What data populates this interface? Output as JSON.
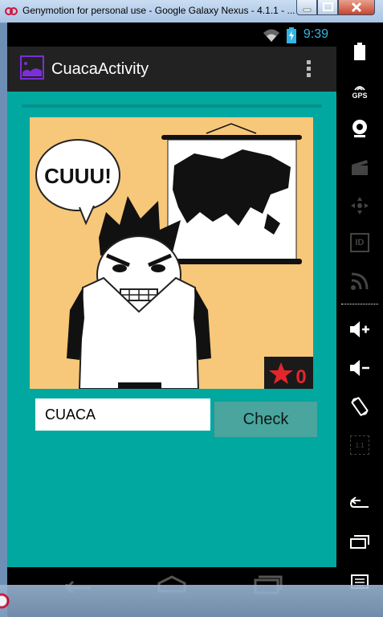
{
  "window": {
    "title": "Genymotion for personal use - Google Galaxy Nexus - 4.1.1 - ..."
  },
  "statusbar": {
    "time": "9:39"
  },
  "actionbar": {
    "title": "CuacaActivity"
  },
  "quiz": {
    "speech_bubble": "CUUU!",
    "score": "0",
    "answer_value": "CUACA",
    "check_label": "Check"
  },
  "side_panel": {
    "gps_label": "GPS",
    "id_label": "ID",
    "pixel_label": "1:1"
  },
  "colors": {
    "content_bg": "#00a8a0",
    "button_bg": "#4aa59e",
    "clock": "#33b5e5",
    "app_icon": "#7b2fd6",
    "card_bg": "#f7c77a",
    "score_star": "#e3262b"
  },
  "icons": {
    "status": [
      "wifi-icon",
      "battery-charging-icon"
    ],
    "actionbar": [
      "app-image-icon",
      "overflow-menu-icon"
    ],
    "side_panel": [
      "battery-icon",
      "gps-icon",
      "webcam-icon",
      "clapper-icon",
      "dpad-icon",
      "id-icon",
      "rss-icon",
      "volume-up-icon",
      "volume-down-icon",
      "rotate-icon",
      "pixel-perfect-icon",
      "back-icon",
      "recent-apps-icon",
      "menu-icon"
    ]
  }
}
